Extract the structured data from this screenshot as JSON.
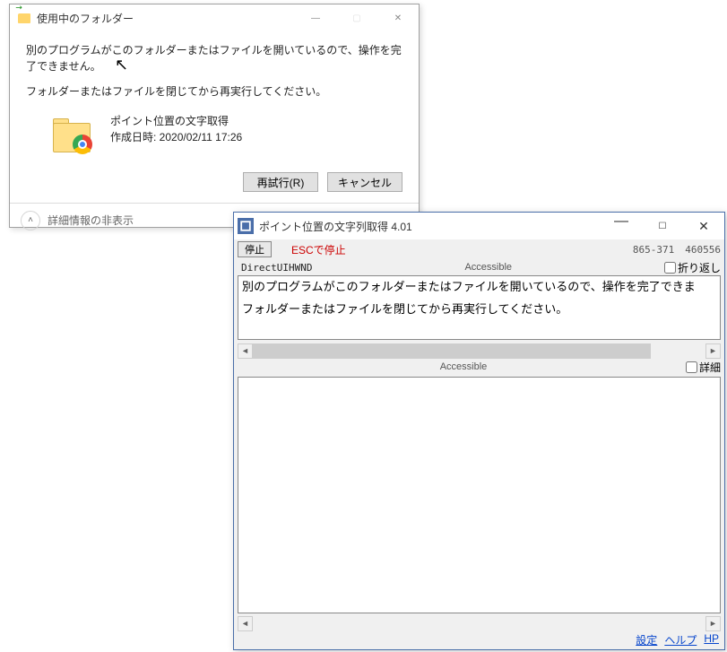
{
  "dialog1": {
    "title": "使用中のフォルダー",
    "message_line1": "別のプログラムがこのフォルダーまたはファイルを開いているので、操作を完了できません。",
    "message_line2": "フォルダーまたはファイルを閉じてから再実行してください。",
    "item_name": "ポイント位置の文字取得",
    "item_date_label": "作成日時: 2020/02/11 17:26",
    "retry_label": "再試行(R)",
    "cancel_label": "キャンセル",
    "details_toggle": "詳細情報の非表示"
  },
  "dialog2": {
    "title": "ポイント位置の文字列取得 4.01",
    "stop_label": "停止",
    "esc_label": "ESCで停止",
    "coords": "865-371",
    "handle": "460556",
    "class_name": "DirectUIHWND",
    "accessible_label": "Accessible",
    "wrap_label": "折り返し",
    "captured_line1": "別のプログラムがこのフォルダーまたはファイルを開いているので、操作を完了できま",
    "captured_line2": "フォルダーまたはファイルを閉じてから再実行してください。",
    "detail_label": "詳細",
    "link_settings": "設定",
    "link_help": "ヘルプ",
    "link_hp": "HP"
  }
}
